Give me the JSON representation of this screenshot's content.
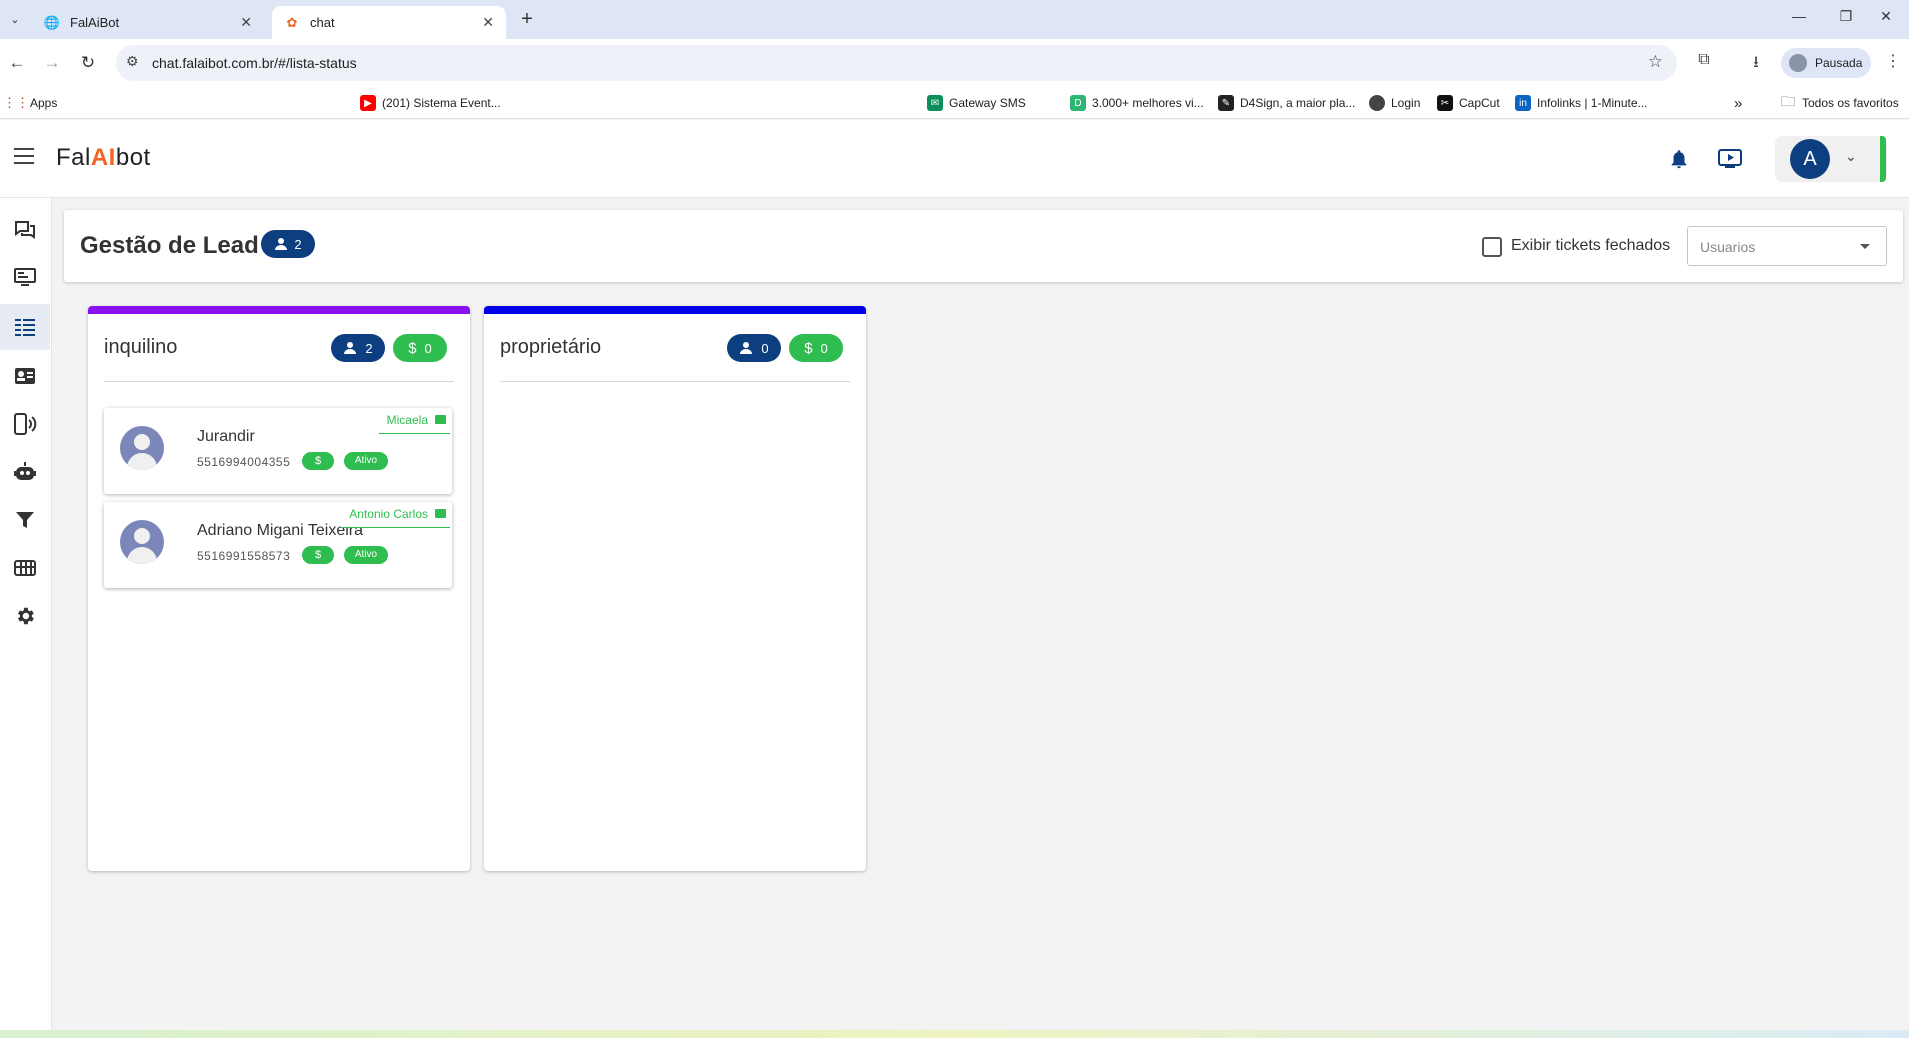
{
  "browser": {
    "tabs": [
      {
        "title": "FalAiBot",
        "active": false
      },
      {
        "title": "chat",
        "active": true
      }
    ],
    "url": "chat.falaibot.com.br/#/lista-status",
    "profile_label": "Pausada",
    "bookmarks": [
      {
        "label": "Apps"
      },
      {
        "label": "(201) Sistema Event..."
      },
      {
        "label": "Gateway SMS"
      },
      {
        "label": "3.000+ melhores vi..."
      },
      {
        "label": "D4Sign, a maior pla..."
      },
      {
        "label": "Login"
      },
      {
        "label": "CapCut"
      },
      {
        "label": "Infolinks | 1-Minute..."
      },
      {
        "label": "Todos os favoritos"
      }
    ],
    "overflow_label": "»"
  },
  "app": {
    "logo_left": "Fal",
    "logo_ai": "AI",
    "logo_right": "bot",
    "user_initial": "A",
    "colors": {
      "primary": "#0d3f80",
      "success": "#2ebd4e",
      "accent": "#f26522"
    }
  },
  "page": {
    "title": "Gestão de Lead",
    "lead_count": "2",
    "show_closed_label": "Exibir tickets fechados",
    "users_placeholder": "Usuarios"
  },
  "columns": [
    {
      "title": "inquilino",
      "color": "#8a12f0",
      "count": "2",
      "value": "0",
      "cards": [
        {
          "name": "Jurandir",
          "phone": "5516994004355",
          "money": "$",
          "status": "Ativo",
          "agent": "Micaela"
        },
        {
          "name": "Adriano Migani Teixeira",
          "phone": "5516991558573",
          "money": "$",
          "status": "Ativo",
          "agent": "Antonio Carlos"
        }
      ]
    },
    {
      "title": "proprietário",
      "color": "#0000e6",
      "count": "0",
      "value": "0",
      "cards": []
    }
  ]
}
